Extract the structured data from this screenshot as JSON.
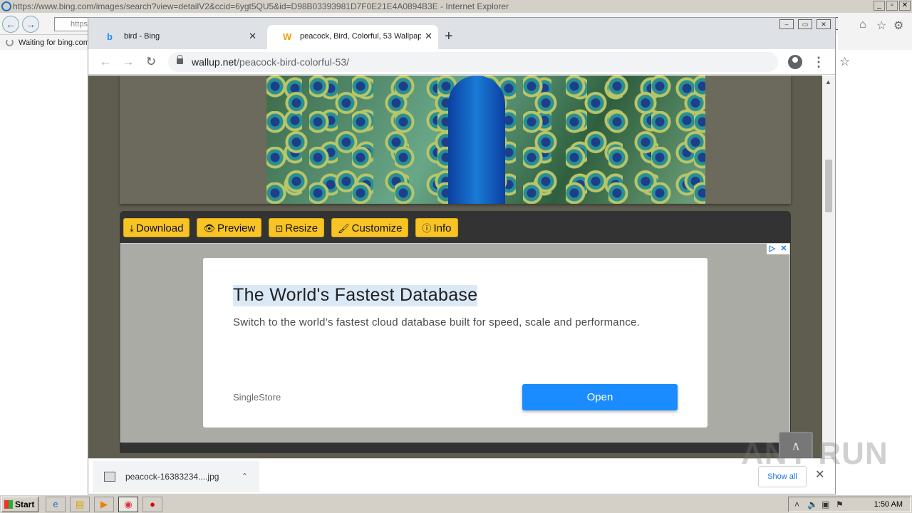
{
  "ie": {
    "title": "https://www.bing.com/images/search?view=detailV2&ccid=6ygt5QU5&id=D98B03393981D7F0E21E4A0894B3E - Internet Explorer",
    "address_partial": "https",
    "status": "Waiting for bing.com",
    "window_buttons": [
      "_",
      "▫",
      "✕"
    ]
  },
  "chrome": {
    "tabs": [
      {
        "title": "bird - Bing",
        "favicon": "b"
      },
      {
        "title": "peacock, Bird, Colorful, 53 Wallpapers",
        "favicon": "W"
      }
    ],
    "url_host": "wallup.net",
    "url_path": "/peacock-bird-colorful-53/"
  },
  "page": {
    "actions": [
      {
        "icon": "⤓",
        "label": "Download"
      },
      {
        "icon": "👁",
        "label": "Preview"
      },
      {
        "icon": "⊡",
        "label": "Resize"
      },
      {
        "icon": "🖌",
        "label": "Customize"
      },
      {
        "icon": "ⓘ",
        "label": "Info"
      }
    ],
    "ad": {
      "title": "The World's Fastest Database",
      "description": "Switch to the world’s fastest cloud database built for speed, scale and performance.",
      "brand": "SingleStore",
      "cta": "Open"
    }
  },
  "downloads": {
    "file_name": "peacock-16383234....jpg",
    "show_all": "Show all"
  },
  "watermark": "ANY RUN",
  "taskbar": {
    "start": "Start",
    "clock": "1:50 AM"
  }
}
